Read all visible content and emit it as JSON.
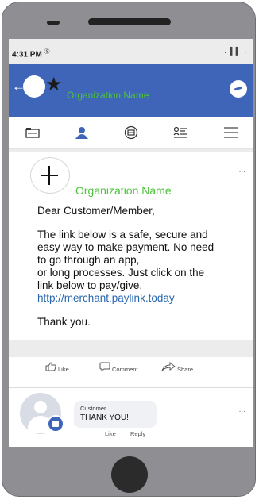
{
  "status_bar": {
    "time": "4:31 PM",
    "time_suffix": "Ⓢ",
    "indicators": ". ▌▌ ."
  },
  "header": {
    "back_glyph": "←",
    "star_glyph": "★",
    "org_name": "Organization Name"
  },
  "nav_icons": [
    "news-feed-icon",
    "groups-icon",
    "marketplace-icon",
    "notifications-icon",
    "menu-icon"
  ],
  "post": {
    "more": "...",
    "org_name": "Organization Name",
    "greeting": "Dear Customer/Member,",
    "body_lines": [
      "The link below is a safe, secure and",
      "easy way to make payment. No need",
      "to go through an app,",
      "or long processes. Just click on the",
      "link below to pay/give."
    ],
    "link": "http://merchant.paylink.today",
    "closing": "Thank you."
  },
  "actions": {
    "like": "Like",
    "comment": "Comment",
    "share": "Share"
  },
  "comment": {
    "name": "Customer",
    "text": "THANK YOU!",
    "like": "Like",
    "reply": "Reply",
    "more": "..."
  },
  "colors": {
    "brand": "#3e65b8",
    "accent_green": "#4ec33c",
    "link": "#2a67b0"
  }
}
